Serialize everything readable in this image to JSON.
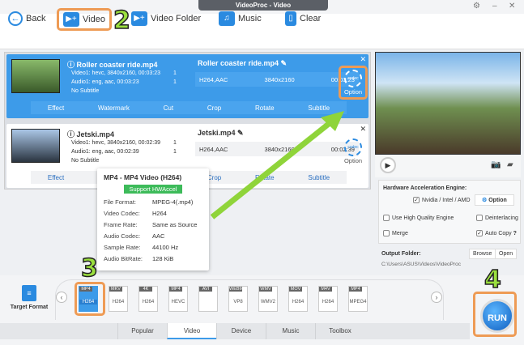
{
  "window": {
    "title": "VideoProc - Video"
  },
  "toolbar": {
    "back": "Back",
    "video": "Video",
    "video_folder": "Video Folder",
    "music": "Music",
    "clear": "Clear"
  },
  "markers": [
    "2",
    "3",
    "4"
  ],
  "items": [
    {
      "name": "Roller coaster ride.mp4",
      "video": "Video1: hevc, 3840x2160, 00:03:23",
      "audio": "Audio1: eng, aac, 00:03:23",
      "subtitle": "No Subtitle",
      "video_count": "1",
      "audio_count": "1",
      "out_name": "Roller coaster ride.mp4",
      "codec": "H264,AAC",
      "resolution": "3840x2160",
      "duration": "00:03:23",
      "option": "Option",
      "selected": true
    },
    {
      "name": "Jetski.mp4",
      "video": "Video1: hevc, 3840x2160, 00:02:39",
      "audio": "Audio1: eng, aac, 00:02:39",
      "subtitle": "No Subtitle",
      "video_count": "1",
      "audio_count": "1",
      "out_name": "Jetski.mp4",
      "codec": "H264,AAC",
      "resolution": "3840x2160",
      "duration": "00:02:39",
      "option": "Option",
      "selected": false
    }
  ],
  "actions": [
    "Effect",
    "Watermark",
    "Cut",
    "Crop",
    "Rotate",
    "Subtitle"
  ],
  "tooltip": {
    "title": "MP4 - MP4 Video (H264)",
    "badge": "Support HWAccel",
    "rows": [
      [
        "File Format:",
        "MPEG-4(.mp4)"
      ],
      [
        "Video Codec:",
        "H264"
      ],
      [
        "Frame Rate:",
        "Same as Source"
      ],
      [
        "Audio Codec:",
        "AAC"
      ],
      [
        "Sample Rate:",
        "44100 Hz"
      ],
      [
        "Audio BitRate:",
        "128 KiB"
      ]
    ]
  },
  "settings": {
    "hw_title": "Hardware Acceleration Engine:",
    "hw_check": "Nvidia / Intel / AMD",
    "option": "Option",
    "high_quality": "Use High Quality Engine",
    "deinterlacing": "Deinterlacing",
    "merge": "Merge",
    "auto_copy": "Auto Copy",
    "help": "?",
    "output_label": "Output Folder:",
    "output_path": "C:\\Users\\ASUS\\Videos\\VideoProc",
    "browse": "Browse",
    "open": "Open"
  },
  "target_format": "Target Format",
  "formats": [
    [
      "MP4",
      "H264"
    ],
    [
      "MKV",
      "H264"
    ],
    [
      "4K",
      "H264"
    ],
    [
      "MP4",
      "HEVC"
    ],
    [
      "AVI",
      ""
    ],
    [
      "WEBM",
      "VP8"
    ],
    [
      "WMV",
      "WMV2"
    ],
    [
      "MOV",
      "H264"
    ],
    [
      "M4V",
      "H264"
    ],
    [
      "MP4",
      "MPEG4"
    ]
  ],
  "tabs": [
    "Popular",
    "Video",
    "Device",
    "Music",
    "Toolbox"
  ],
  "run": "RUN",
  "colors": {
    "accent": "#3d9be9",
    "highlight": "#ee9b55",
    "arrow": "#8fd43a"
  }
}
